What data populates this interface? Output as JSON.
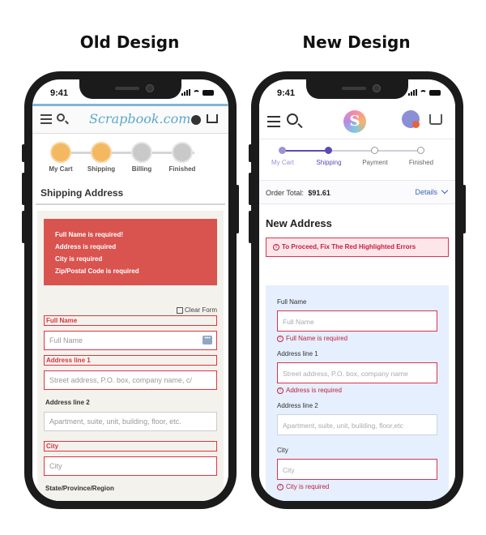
{
  "headings": {
    "old": "Old Design",
    "new": "New Design"
  },
  "status_time": "9:41",
  "old": {
    "logo": "Scrapbook.com",
    "steps": [
      "My Cart",
      "Shipping",
      "Billing",
      "Finished"
    ],
    "title": "Shipping Address",
    "errors": [
      "Full Name is required!",
      "Address is required",
      "City is required",
      "Zip/Postal Code is required"
    ],
    "clear_form": "Clear Form",
    "fields": {
      "full_name": {
        "label": "Full Name",
        "placeholder": "Full Name"
      },
      "address1": {
        "label": "Address line 1",
        "placeholder": "Street address, P.O. box, company name, c/"
      },
      "address2": {
        "label": "Address line 2",
        "placeholder": "Apartment, suite, unit, building, floor,     etc."
      },
      "city": {
        "label": "City",
        "placeholder": "City"
      },
      "state": {
        "label": "State/Province/Region"
      }
    },
    "colors": {
      "accent": "#f4b860",
      "error": "#d9534f"
    }
  },
  "new": {
    "logo_letter": "S",
    "steps": [
      "My Cart",
      "Shipping",
      "Payment",
      "Finished"
    ],
    "order_total_label": "Order Total:",
    "order_total_value": "$91.61",
    "details": "Details",
    "title": "New Address",
    "banner": "To Proceed, Fix The Red Highlighted Errors",
    "fields": {
      "full_name": {
        "label": "Full Name",
        "placeholder": "Full Name",
        "error": "Full Name is required"
      },
      "address1": {
        "label": "Address line 1",
        "placeholder": "Street address, P.O. box, company name",
        "error": "Address is required"
      },
      "address2": {
        "label": "Address line 2",
        "placeholder": "Apartment, suite, unit, building, floor,etc"
      },
      "city": {
        "label": "City",
        "placeholder": "City",
        "error": "City is required"
      }
    },
    "colors": {
      "accent": "#5b4bb3",
      "error": "#d9344f",
      "form_bg": "#e5effd"
    }
  }
}
